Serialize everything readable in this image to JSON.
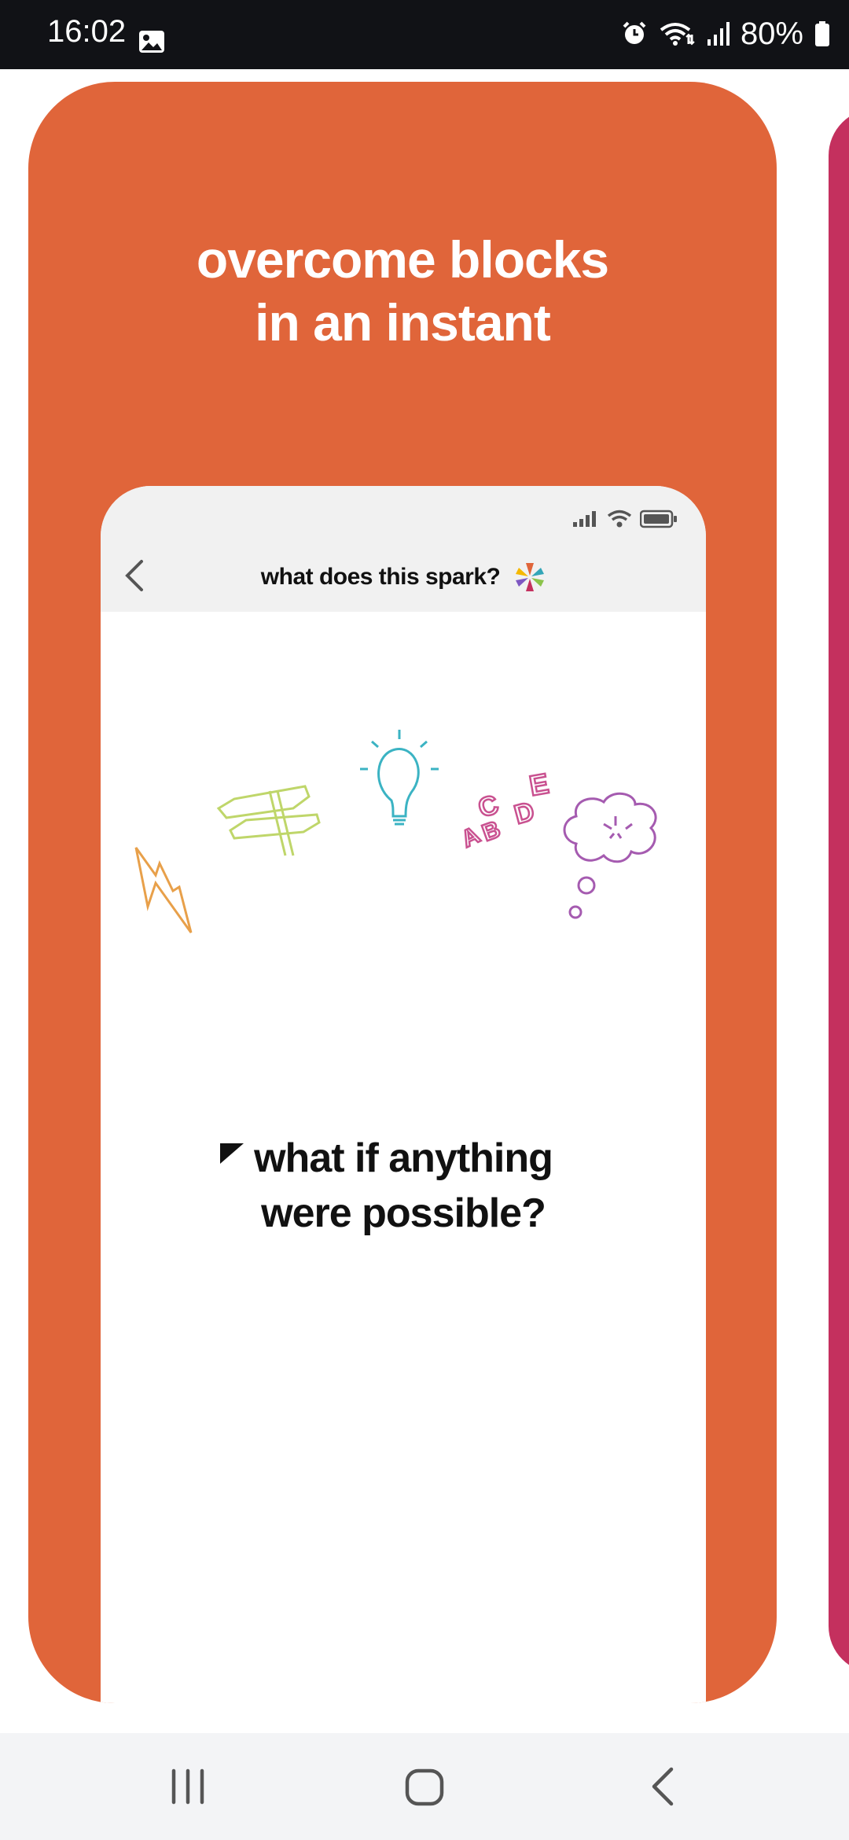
{
  "status_bar": {
    "time": "16:02",
    "battery": "80%",
    "icons": [
      "image-icon",
      "alarm-icon",
      "wifi-icon",
      "signal-icon",
      "battery-icon"
    ]
  },
  "card": {
    "headline_line1": "overcome blocks",
    "headline_line2": "in an instant",
    "color": "#E0653A",
    "next_card_color": "#C4305E"
  },
  "mockup": {
    "title": "what does this spark?",
    "question_line1": "what if anything",
    "question_line2": "were possible?",
    "illustrations": [
      "lightning-icon",
      "signpost-icon",
      "lightbulb-icon",
      "letters-icon",
      "thought-bubble-icon"
    ]
  },
  "nav_bar": {
    "buttons": [
      "recent-apps-button",
      "home-button",
      "back-button"
    ]
  }
}
